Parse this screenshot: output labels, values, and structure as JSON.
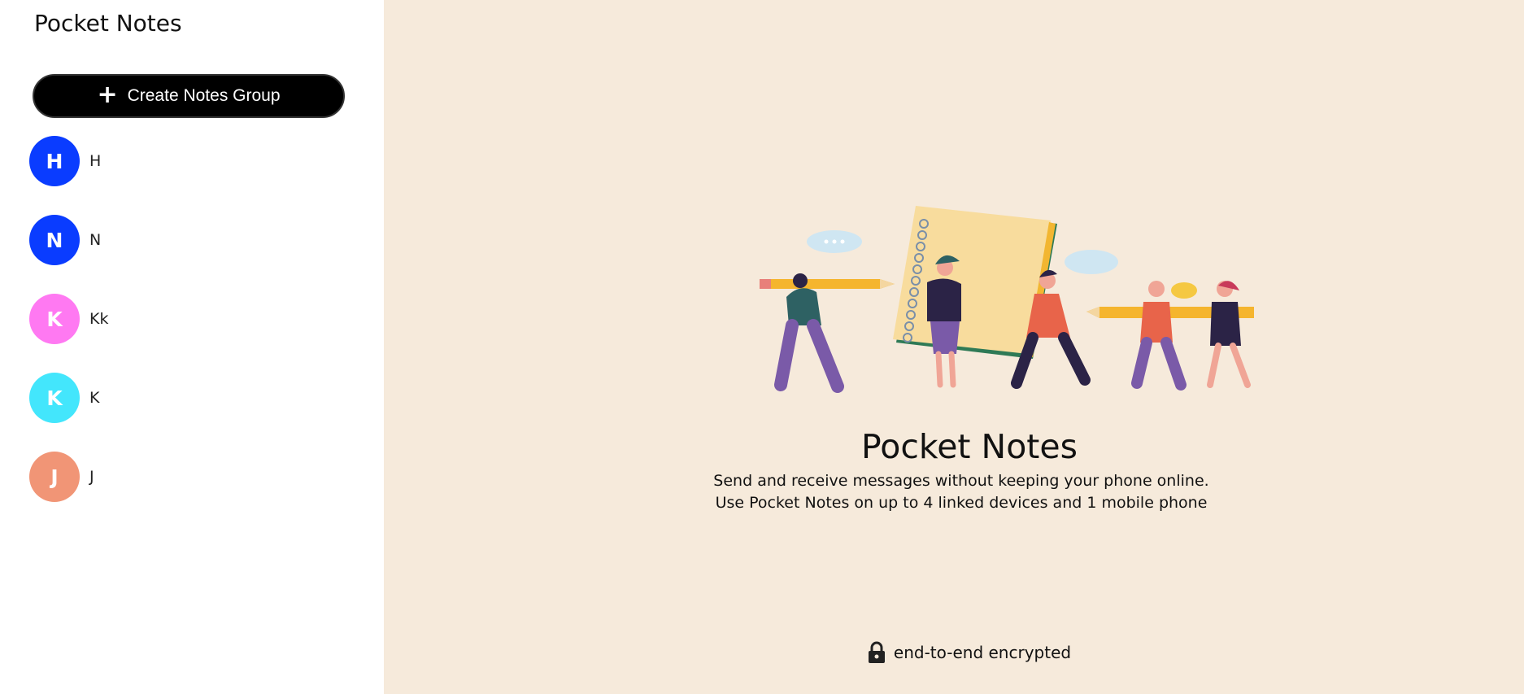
{
  "sidebar": {
    "title": "Pocket Notes",
    "create_button": {
      "icon": "plus-icon",
      "label": "Create Notes Group"
    },
    "groups": [
      {
        "initial": "H",
        "name": "H",
        "color": "#0a3cff"
      },
      {
        "initial": "N",
        "name": "N",
        "color": "#0a3cff"
      },
      {
        "initial": "K",
        "name": "Kk",
        "color": "#ff79f2"
      },
      {
        "initial": "K",
        "name": "K",
        "color": "#43e6fc"
      },
      {
        "initial": "J",
        "name": "J",
        "color": "#f19576"
      }
    ]
  },
  "main": {
    "illustration": "people-carrying-pencils-and-notebook",
    "title": "Pocket Notes",
    "description_line1": "Send and receive messages without keeping your phone online.",
    "description_line2": "Use Pocket Notes on up to 4 linked devices and 1 mobile phone",
    "footer": {
      "icon": "lock-icon",
      "text": "end-to-end encrypted"
    },
    "background_color": "#f6eadb"
  }
}
